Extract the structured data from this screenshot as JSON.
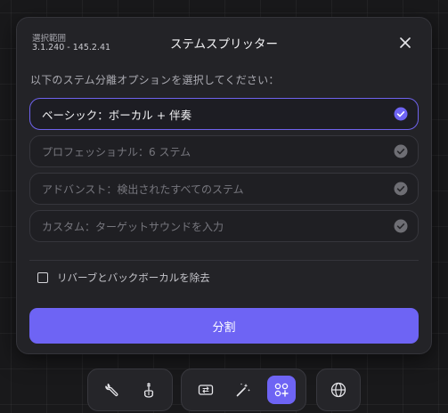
{
  "dialog": {
    "range_label": "選択範囲",
    "range_value": "3.1.240 - 145.2.41",
    "title": "ステムスプリッター",
    "prompt": "以下のステム分離オプションを選択してください：",
    "options": [
      {
        "label": "ベーシック：ボーカル + 伴奏",
        "selected": true
      },
      {
        "label": "プロフェッショナル：6 ステム",
        "selected": false
      },
      {
        "label": "アドバンスト：検出されたすべてのステム",
        "selected": false
      },
      {
        "label": "カスタム：ターゲットサウンドを入力",
        "selected": false
      }
    ],
    "checkbox_label": "リバーブとバックボーカルを除去",
    "checkbox_checked": false,
    "split_button": "分割"
  },
  "toolbar": {
    "groups": [
      {
        "tools": [
          "wrench-icon",
          "guitar-tuner-icon"
        ]
      },
      {
        "tools": [
          "loop-swap-icon",
          "magic-wand-icon",
          "stem-split-icon"
        ],
        "active": "stem-split-icon"
      },
      {
        "tools": [
          "globe-icon"
        ]
      }
    ]
  },
  "colors": {
    "accent": "#6e64f4",
    "background": "#19191b",
    "panel": "#232327"
  }
}
